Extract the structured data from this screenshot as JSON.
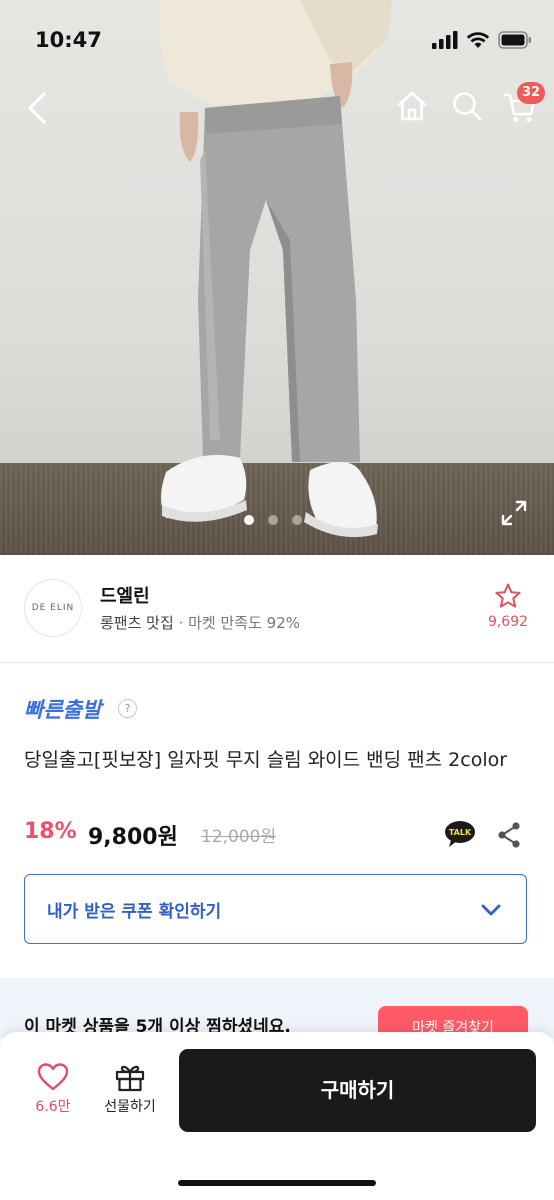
{
  "status_bar": {
    "time": "10:47"
  },
  "header": {
    "cart_count": "32"
  },
  "gallery": {
    "image_count": 3,
    "active_index": 0
  },
  "shop": {
    "logo_text": "DE ELIN",
    "name": "드엘린",
    "tag": "롱팬츠 맛집",
    "separator": "·",
    "satisfaction": "마켓 만족도 92%",
    "favorite_count": "9,692"
  },
  "product": {
    "badge": "빠른출발",
    "help": "?",
    "title": "당일출고[핏보장] 일자핏 무지 슬림 와이드 밴딩 팬츠 2color",
    "discount": "18%",
    "price": "9,800원",
    "original_price": "12,000원"
  },
  "coupon": {
    "label": "내가 받은 쿠폰 확인하기"
  },
  "banner": {
    "text": "이 마켓 상품을 5개 이상 찜하셨네요.",
    "button": "마켓 즐겨찾기"
  },
  "bottom_bar": {
    "like_count": "6.6만",
    "gift_label": "선물하기",
    "buy_label": "구매하기"
  },
  "colors": {
    "accent_blue": "#3b6fe0",
    "discount_pink": "#f0506e",
    "badge_red": "#f25a5a",
    "buy_button": "#1a1a1a"
  },
  "icons": [
    "back-icon",
    "home-icon",
    "search-icon",
    "cart-icon",
    "expand-icon",
    "star-icon",
    "kakao-talk-icon",
    "share-icon",
    "chevron-down-icon",
    "heart-icon",
    "gift-icon"
  ]
}
